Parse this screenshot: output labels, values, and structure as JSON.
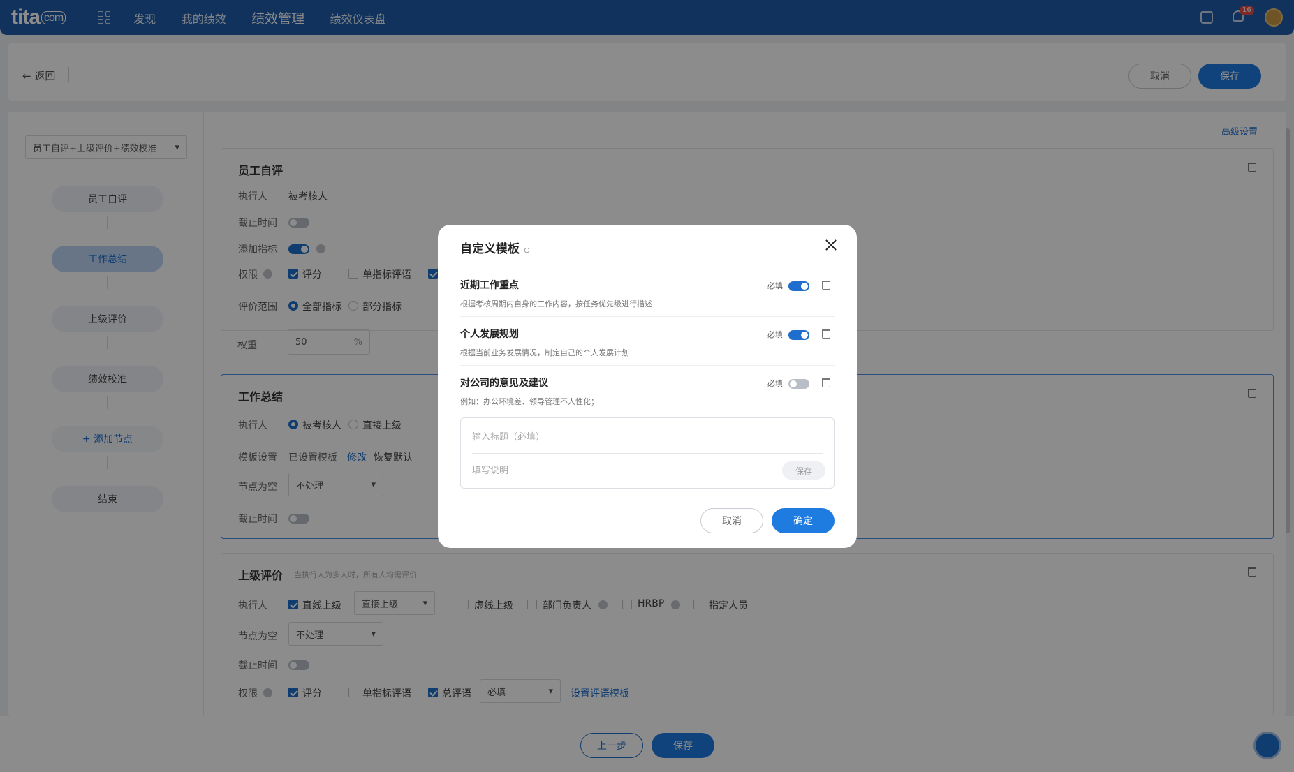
{
  "topbar": {
    "logo": "tita",
    "logo_suffix": "com",
    "nav": [
      "发现",
      "我的绩效",
      "绩效管理",
      "绩效仪表盘"
    ],
    "notification_count": "16"
  },
  "subbar": {
    "back_label": "返回",
    "cancel_label": "取消",
    "save_label": "保存"
  },
  "left": {
    "flow_select": "员工自评+上级评价+绩效校准",
    "nodes": [
      "员工自评",
      "工作总结",
      "上级评价",
      "绩效校准",
      "添加节点",
      "结束"
    ]
  },
  "advanced_settings": "高级设置",
  "sec1": {
    "title": "员工自评",
    "executor_label": "执行人",
    "executor_value": "被考核人",
    "deadline_label": "截止时间",
    "add_indicator_label": "添加指标",
    "permission_label": "权限",
    "perm_score": "评分",
    "perm_single": "单指标评语",
    "range_label": "评价范围",
    "range_all": "全部指标",
    "range_part": "部分指标",
    "weight_label": "权重",
    "weight_value": "50",
    "weight_unit": "%"
  },
  "sec2": {
    "title": "工作总结",
    "executor_label": "执行人",
    "exec_self": "被考核人",
    "exec_direct": "直接上级",
    "template_label": "模板设置",
    "template_status": "已设置模板",
    "edit_link": "修改",
    "restore_link": "恢复默认",
    "empty_label": "节点为空",
    "empty_value": "不处理",
    "deadline_label": "截止时间"
  },
  "sec3": {
    "title": "上级评价",
    "hint": "当执行人为多人时，所有人均需评价",
    "executor_label": "执行人",
    "exec_line": "直线上级",
    "exec_line_select": "直接上级",
    "exec_virtual": "虚线上级",
    "exec_dept": "部门负责人",
    "exec_hrbp": "HRBP",
    "exec_assign": "指定人员",
    "empty_label": "节点为空",
    "empty_value": "不处理",
    "deadline_label": "截止时间",
    "permission_label": "权限",
    "perm_score": "评分",
    "perm_single": "单指标评语",
    "perm_total": "总评语",
    "perm_total_select": "必填",
    "comment_template_link": "设置评语模板"
  },
  "footer": {
    "prev_label": "上一步",
    "save_label": "保存"
  },
  "modal": {
    "title": "自定义模板",
    "items": [
      {
        "title": "近期工作重点",
        "desc": "根据考核周期内自身的工作内容，按任务优先级进行描述",
        "required_label": "必填",
        "required": true
      },
      {
        "title": "个人发展规划",
        "desc": "根据当前业务发展情况，制定自己的个人发展计划",
        "required_label": "必填",
        "required": true
      },
      {
        "title": "对公司的意见及建议",
        "desc": "例如：办公环境差、领导管理不人性化；",
        "required_label": "必填",
        "required": false
      }
    ],
    "title_placeholder": "输入标题（必填）",
    "desc_placeholder": "填写说明",
    "inline_save": "保存",
    "cancel_label": "取消",
    "confirm_label": "确定"
  }
}
